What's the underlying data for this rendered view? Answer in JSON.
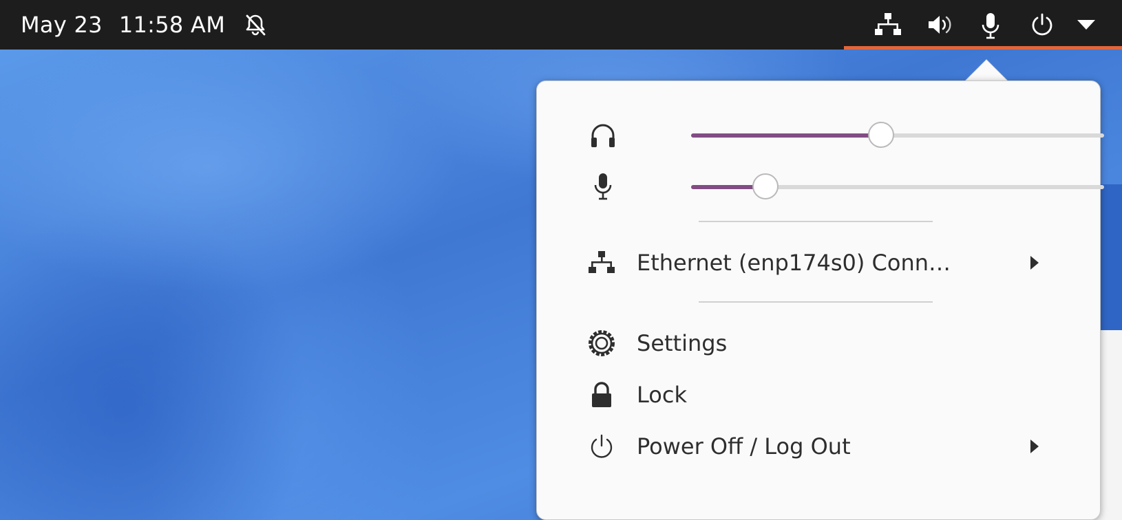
{
  "topbar": {
    "date": "May 23",
    "time": "11:58 AM",
    "icons": [
      "bell-off-icon",
      "network-icon",
      "volume-icon",
      "microphone-icon",
      "power-icon",
      "dropdown-icon"
    ]
  },
  "menu": {
    "output_volume": {
      "icon": "headphones-icon",
      "level": 0.46
    },
    "input_volume": {
      "icon": "microphone-icon",
      "level": 0.18
    },
    "ethernet": {
      "icon": "network-icon",
      "label": "Ethernet (enp174s0) Conn…"
    },
    "settings": {
      "icon": "gear-icon",
      "label": "Settings"
    },
    "lock": {
      "icon": "lock-icon",
      "label": "Lock"
    },
    "power": {
      "icon": "power-icon",
      "label": "Power Off / Log Out"
    }
  },
  "colors": {
    "topbar_bg": "#1d1d1d",
    "accent_underline": "#e0663c",
    "slider_fill": "#824c84",
    "menu_bg": "#fafafa",
    "desktop_blue": "#4a86df"
  }
}
